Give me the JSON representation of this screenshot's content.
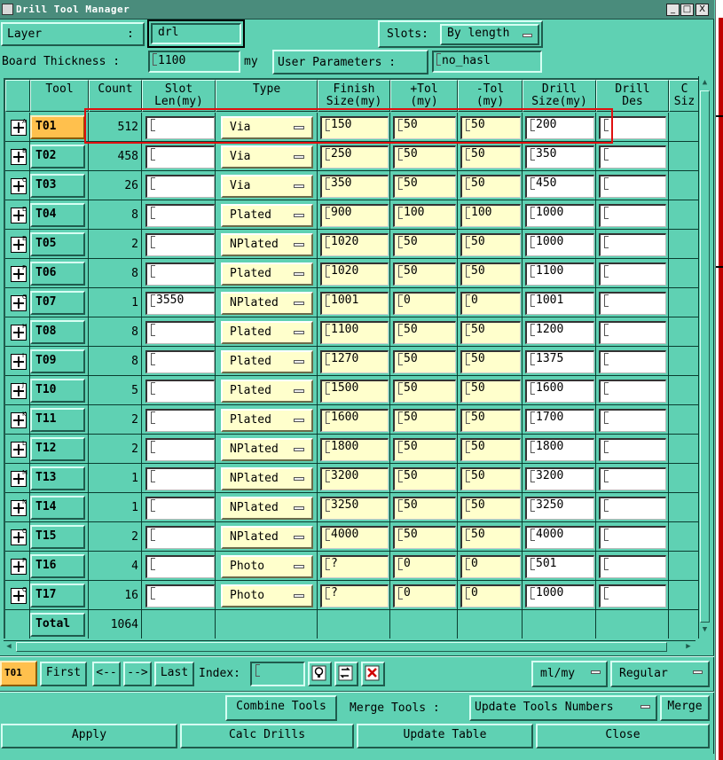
{
  "window": {
    "title": "Drill Tool Manager",
    "min": "_",
    "max": "□",
    "close": "X"
  },
  "header": {
    "layer_label": "Layer",
    "layer_colon": ":",
    "layer_value": "drl",
    "slots_label": "Slots:",
    "slots_value": "By length",
    "thickness_label": "Board Thickness :",
    "thickness_value": "1100",
    "thickness_unit": "my",
    "user_params_label": "User Parameters :",
    "user_params_value": "no_hasl"
  },
  "columns": [
    {
      "key": "tool",
      "label": "Tool"
    },
    {
      "key": "count",
      "label": "Count"
    },
    {
      "key": "slot",
      "label": "Slot\nLen(my)"
    },
    {
      "key": "type",
      "label": "Type"
    },
    {
      "key": "finish",
      "label": "Finish\nSize(my)"
    },
    {
      "key": "ptol",
      "label": "+Tol\n(my)"
    },
    {
      "key": "ntol",
      "label": "-Tol\n(my)"
    },
    {
      "key": "drill",
      "label": "Drill\nSize(my)"
    },
    {
      "key": "des",
      "label": "Drill\nDes"
    },
    {
      "key": "extra",
      "label": "C\nSiz"
    }
  ],
  "rows": [
    {
      "tool": "T01",
      "sup": "A",
      "count": "512",
      "slot": "",
      "type": "Via",
      "finish": "150",
      "ptol": "50",
      "ntol": "50",
      "drill": "200",
      "des": ""
    },
    {
      "tool": "T02",
      "sup": "B",
      "count": "458",
      "slot": "",
      "type": "Via",
      "finish": "250",
      "ptol": "50",
      "ntol": "50",
      "drill": "350",
      "des": ""
    },
    {
      "tool": "T03",
      "sup": "C",
      "count": "26",
      "slot": "",
      "type": "Via",
      "finish": "350",
      "ptol": "50",
      "ntol": "50",
      "drill": "450",
      "des": ""
    },
    {
      "tool": "T04",
      "sup": "D",
      "count": "8",
      "slot": "",
      "type": "Plated",
      "finish": "900",
      "ptol": "100",
      "ntol": "100",
      "drill": "1000",
      "des": ""
    },
    {
      "tool": "T05",
      "sup": "E",
      "count": "2",
      "slot": "",
      "type": "NPlated",
      "finish": "1020",
      "ptol": "50",
      "ntol": "50",
      "drill": "1000",
      "des": ""
    },
    {
      "tool": "T06",
      "sup": "F",
      "count": "8",
      "slot": "",
      "type": "Plated",
      "finish": "1020",
      "ptol": "50",
      "ntol": "50",
      "drill": "1100",
      "des": ""
    },
    {
      "tool": "T07",
      "sup": "G",
      "count": "1",
      "slot": "3550",
      "type": "NPlated",
      "finish": "1001",
      "ptol": "0",
      "ntol": "0",
      "drill": "1001",
      "des": ""
    },
    {
      "tool": "T08",
      "sup": "H",
      "count": "8",
      "slot": "",
      "type": "Plated",
      "finish": "1100",
      "ptol": "50",
      "ntol": "50",
      "drill": "1200",
      "des": ""
    },
    {
      "tool": "T09",
      "sup": "I",
      "count": "8",
      "slot": "",
      "type": "Plated",
      "finish": "1270",
      "ptol": "50",
      "ntol": "50",
      "drill": "1375",
      "des": ""
    },
    {
      "tool": "T10",
      "sup": "J",
      "count": "5",
      "slot": "",
      "type": "Plated",
      "finish": "1500",
      "ptol": "50",
      "ntol": "50",
      "drill": "1600",
      "des": ""
    },
    {
      "tool": "T11",
      "sup": "K",
      "count": "2",
      "slot": "",
      "type": "Plated",
      "finish": "1600",
      "ptol": "50",
      "ntol": "50",
      "drill": "1700",
      "des": ""
    },
    {
      "tool": "T12",
      "sup": "L",
      "count": "2",
      "slot": "",
      "type": "NPlated",
      "finish": "1800",
      "ptol": "50",
      "ntol": "50",
      "drill": "1800",
      "des": ""
    },
    {
      "tool": "T13",
      "sup": "M",
      "count": "1",
      "slot": "",
      "type": "NPlated",
      "finish": "3200",
      "ptol": "50",
      "ntol": "50",
      "drill": "3200",
      "des": ""
    },
    {
      "tool": "T14",
      "sup": "N",
      "count": "1",
      "slot": "",
      "type": "NPlated",
      "finish": "3250",
      "ptol": "50",
      "ntol": "50",
      "drill": "3250",
      "des": ""
    },
    {
      "tool": "T15",
      "sup": "O",
      "count": "2",
      "slot": "",
      "type": "NPlated",
      "finish": "4000",
      "ptol": "50",
      "ntol": "50",
      "drill": "4000",
      "des": ""
    },
    {
      "tool": "T16",
      "sup": "P",
      "count": "4",
      "slot": "",
      "type": "Photo",
      "finish": "?",
      "ptol": "0",
      "ntol": "0",
      "drill": "501",
      "des": ""
    },
    {
      "tool": "T17",
      "sup": "Q",
      "count": "16",
      "slot": "",
      "type": "Photo",
      "finish": "?",
      "ptol": "0",
      "ntol": "0",
      "drill": "1000",
      "des": ""
    }
  ],
  "total": {
    "label": "Total",
    "count": "1064"
  },
  "nav": {
    "current": "T01",
    "first": "First",
    "prev": "<--",
    "next": "-->",
    "last": "Last",
    "index_label": "Index:",
    "index_value": "",
    "units": "ml/my",
    "mode": "Regular"
  },
  "actions": {
    "combine": "Combine Tools",
    "merge_label": "Merge Tools :",
    "update_numbers": "Update Tools Numbers",
    "merge": "Merge"
  },
  "bottom": {
    "apply": "Apply",
    "calc": "Calc Drills",
    "update_table": "Update Table",
    "close": "Close"
  },
  "colors": {
    "panel": "#5fd1b3",
    "selected": "#ffc04d",
    "input_yellow": "#ffffcc",
    "highlight": "#e01010"
  }
}
